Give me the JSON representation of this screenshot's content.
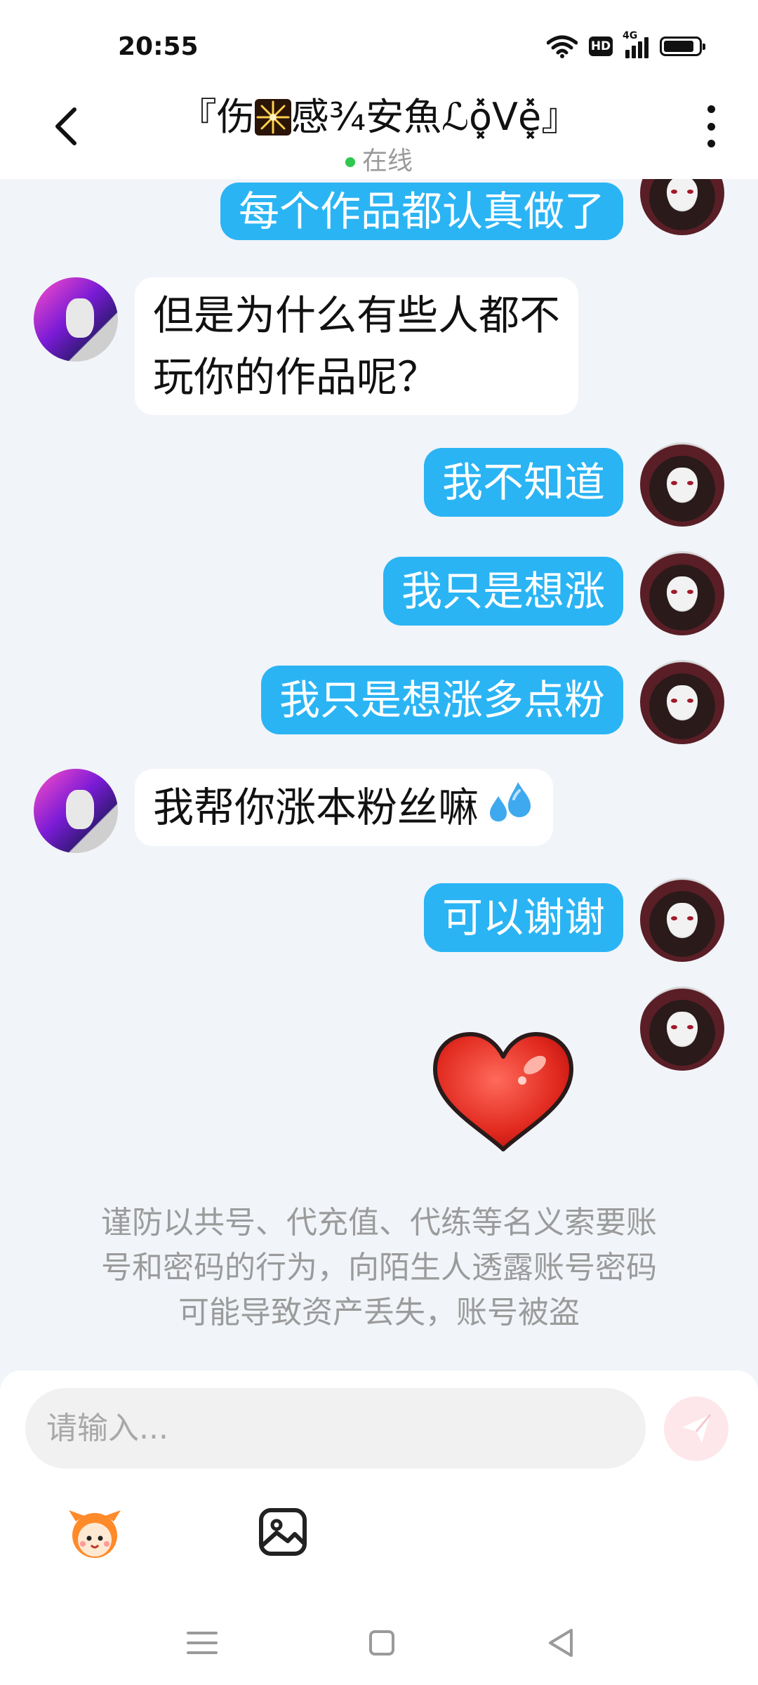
{
  "status_bar": {
    "time": "20:55",
    "icons": [
      "wifi-icon",
      "hd-icon",
      "signal-4g-icon",
      "battery-icon"
    ],
    "hd_label": "HD",
    "network_label": "4G"
  },
  "header": {
    "title_prefix": "『伤",
    "title_suffix": "感¾安魚ℒo͓̽ᐯe͓̽』",
    "title_emoji": "firework-icon",
    "status": "在线",
    "status_color": "#2fc84d"
  },
  "messages": [
    {
      "side": "me",
      "text": "每个作品都认真做了"
    },
    {
      "side": "them",
      "lines": [
        "但是为什么有些人都不",
        "玩你的作品呢？"
      ]
    },
    {
      "side": "me",
      "text": "我不知道"
    },
    {
      "side": "me",
      "text": "我只是想涨"
    },
    {
      "side": "me",
      "text": "我只是想涨多点粉"
    },
    {
      "side": "them",
      "text": "我帮你涨本粉丝嘛",
      "emoji": "sweat-drops-icon"
    },
    {
      "side": "me",
      "text": "可以谢谢"
    },
    {
      "side": "me",
      "sticker": "red-heart-sticker"
    }
  ],
  "notice": {
    "lines": [
      "谨防以共号、代充值、代练等名义索要账",
      "号和密码的行为，向陌生人透露账号密码",
      "可能导致资产丢失，账号被盗"
    ]
  },
  "composer": {
    "placeholder": "请输入...",
    "send_icon": "paper-plane-icon",
    "tools": [
      "sticker-mascot-icon",
      "image-icon"
    ]
  },
  "colors": {
    "accent_bubble": "#2ab4f4",
    "background": "#f1f4f9"
  },
  "nav_bar": [
    "menu-icon",
    "home-square-icon",
    "back-triangle-icon"
  ]
}
